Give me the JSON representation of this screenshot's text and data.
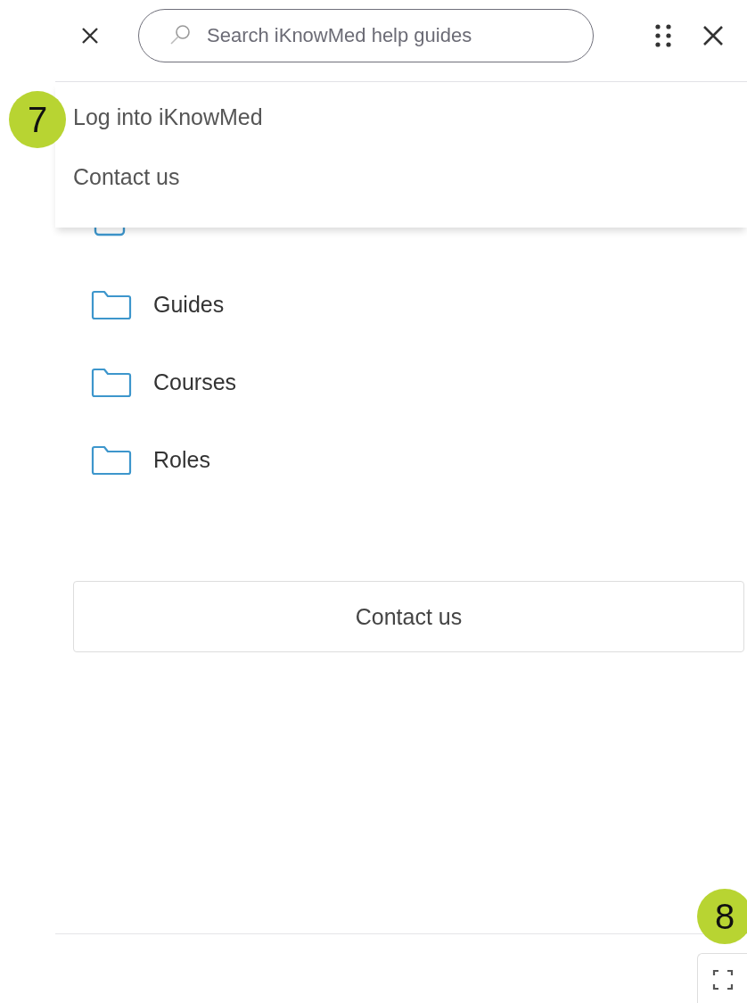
{
  "header": {
    "search": {
      "placeholder": "Search iKnowMed help guides"
    }
  },
  "menu": {
    "items": [
      {
        "label": "Log into iKnowMed"
      },
      {
        "label": "Contact us"
      }
    ]
  },
  "nav": {
    "items": [
      {
        "label": "Guides",
        "kind": "folder"
      },
      {
        "label": "Courses",
        "kind": "folder"
      },
      {
        "label": "Roles",
        "kind": "folder"
      }
    ]
  },
  "contact_button": {
    "label": "Contact us"
  },
  "callouts": [
    {
      "label": "7",
      "kind": "menu"
    },
    {
      "label": "8",
      "kind": "expand"
    }
  ]
}
